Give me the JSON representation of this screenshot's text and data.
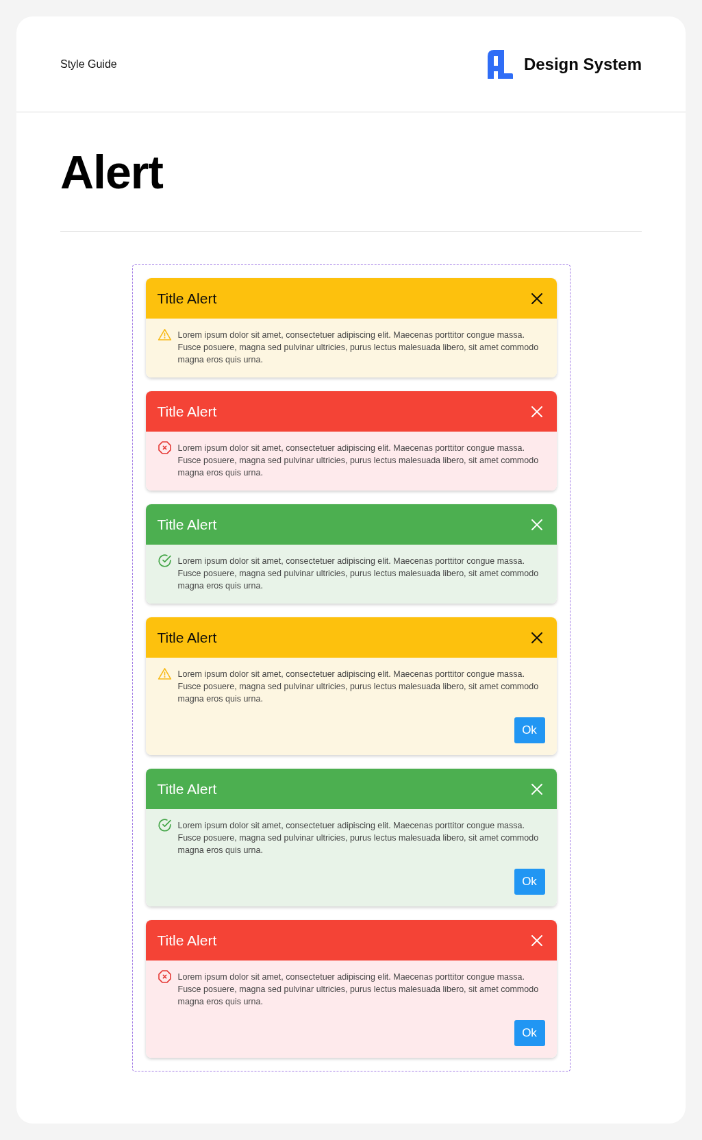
{
  "header": {
    "section": "Style Guide",
    "brand": "Design System"
  },
  "title": "Alert",
  "alerts": [
    {
      "kind": "warning",
      "title": "Title Alert",
      "message": "Lorem ipsum dolor sit amet, consectetuer adipiscing elit. Maecenas porttitor congue massa. Fusce posuere, magna sed pulvinar ultricies, purus lectus malesuada libero, sit amet commodo magna eros quis urna."
    },
    {
      "kind": "error",
      "title": "Title Alert",
      "message": "Lorem ipsum dolor sit amet, consectetuer adipiscing elit. Maecenas porttitor congue massa. Fusce posuere, magna sed pulvinar ultricies, purus lectus malesuada libero, sit amet commodo magna eros quis urna."
    },
    {
      "kind": "success",
      "title": "Title Alert",
      "message": "Lorem ipsum dolor sit amet, consectetuer adipiscing elit. Maecenas porttitor congue massa. Fusce posuere, magna sed pulvinar ultricies, purus lectus malesuada libero, sit amet commodo magna eros quis urna."
    },
    {
      "kind": "warning",
      "title": "Title Alert",
      "message": "Lorem ipsum dolor sit amet, consectetuer adipiscing elit. Maecenas porttitor congue massa. Fusce posuere, magna sed pulvinar ultricies, purus lectus malesuada libero, sit amet commodo magna eros quis urna.",
      "button": "Ok"
    },
    {
      "kind": "success",
      "title": "Title Alert",
      "message": "Lorem ipsum dolor sit amet, consectetuer adipiscing elit. Maecenas porttitor congue massa. Fusce posuere, magna sed pulvinar ultricies, purus lectus malesuada libero, sit amet commodo magna eros quis urna.",
      "button": "Ok"
    },
    {
      "kind": "error",
      "title": "Title Alert",
      "message": "Lorem ipsum dolor sit amet, consectetuer adipiscing elit. Maecenas porttitor congue massa. Fusce posuere, magna sed pulvinar ultricies, purus lectus malesuada libero, sit amet commodo magna eros quis urna.",
      "button": "Ok"
    }
  ]
}
